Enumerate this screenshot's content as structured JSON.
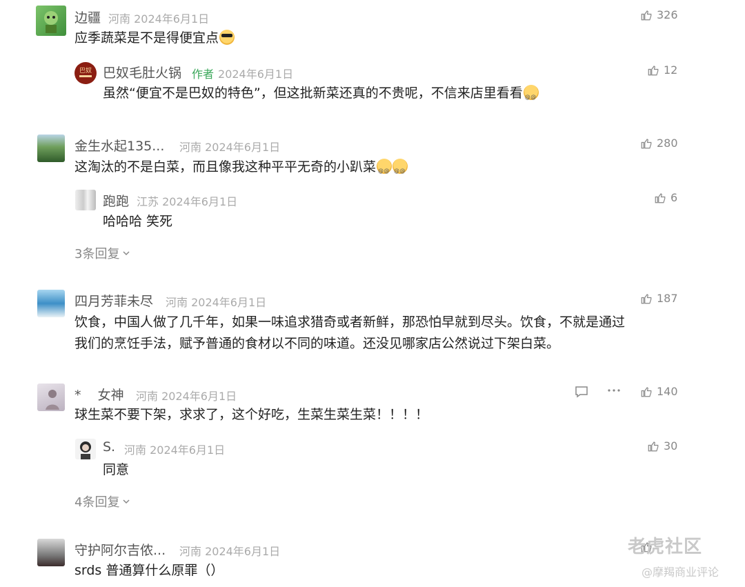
{
  "comments": [
    {
      "user": "边疆",
      "meta": "河南 2024年6月1日",
      "likes": "326",
      "text": "应季蔬菜是不是得便宜点",
      "reply": {
        "user": "巴奴毛肚火锅",
        "tag": "作者",
        "meta": "2024年6月1日",
        "likes": "12",
        "text": "虽然“便宜不是巴奴的特色”，但这批新菜还真的不贵呢，不信来店里看看"
      }
    },
    {
      "user": "金生水起135...",
      "meta": "河南 2024年6月1日",
      "likes": "280",
      "text": "这淘汰的不是白菜，而且像我这种平平无奇的小趴菜",
      "reply": {
        "user": "跑跑",
        "meta": "江苏 2024年6月1日",
        "likes": "6",
        "text": "哈哈哈 笑死"
      },
      "more": "3条回复"
    },
    {
      "user": "四月芳菲未尽",
      "meta": "河南 2024年6月1日",
      "likes": "187",
      "text_lines": [
        "饮食，中国人做了几千年，如果一味追求猎奇或者新鲜，那恐怕早就到尽头。饮食，不就是通过",
        "我们的烹饪手法，赋予普通的食材以不同的味道。还没见哪家店公然说过下架白菜。"
      ]
    },
    {
      "user": "*    女神",
      "meta": "河南 2024年6月1日",
      "likes": "140",
      "text": "球生菜不要下架，求求了，这个好吃，生菜生菜生菜！！！！",
      "reply": {
        "user": "S.",
        "meta": "河南 2024年6月1日",
        "likes": "30",
        "text": "同意"
      },
      "more": "4条回复"
    },
    {
      "user": "守护阿尔吉侬...",
      "meta": "河南 2024年6月1日",
      "likes": "",
      "text": "srds 普通算什么原罪（）"
    }
  ],
  "watermark": {
    "line1": "老虎社区",
    "line2": "@摩羯商业评论"
  },
  "colors": {
    "text": "#222222",
    "meta": "#aaaaaa",
    "username": "#555555",
    "author_tag": "#3aa75a",
    "watermark": "#c9c9c9"
  },
  "icons": [
    "thumbs-up-icon",
    "chevron-down-icon",
    "reply-bubble-icon",
    "ellipsis-icon",
    "emoji-sunglasses-icon",
    "emoji-dizzy-icon"
  ]
}
